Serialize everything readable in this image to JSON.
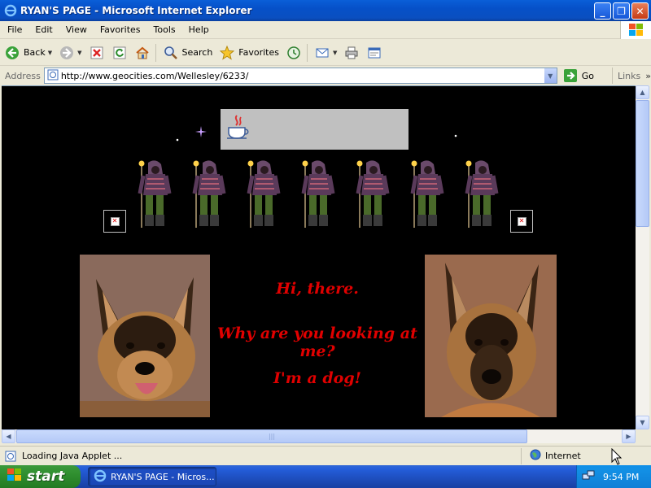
{
  "window": {
    "title": "RYAN'S PAGE - Microsoft Internet Explorer",
    "buttons": {
      "minimize": "_",
      "maximize": "❐",
      "close": "✕"
    }
  },
  "menu": [
    "File",
    "Edit",
    "View",
    "Favorites",
    "Tools",
    "Help"
  ],
  "toolbar": {
    "back_label": "Back",
    "search_label": "Search",
    "favorites_label": "Favorites"
  },
  "address": {
    "label": "Address",
    "url": "http://www.geocities.com/Wellesley/6233/",
    "go_label": "Go",
    "links_label": "Links"
  },
  "page": {
    "message_1": "Hi, there.",
    "message_2": "Why are you looking at me?",
    "message_3": "I'm a dog!",
    "warrior_count": 7
  },
  "status": {
    "text": "Loading Java Applet ...",
    "zone": "Internet"
  },
  "taskbar": {
    "start_label": "start",
    "task_label": "RYAN'S PAGE - Micros...",
    "clock": "9:54 PM"
  },
  "colors": {
    "message": "#e00000",
    "page_background": "#000000",
    "banner_background": "#c0c0c0"
  }
}
